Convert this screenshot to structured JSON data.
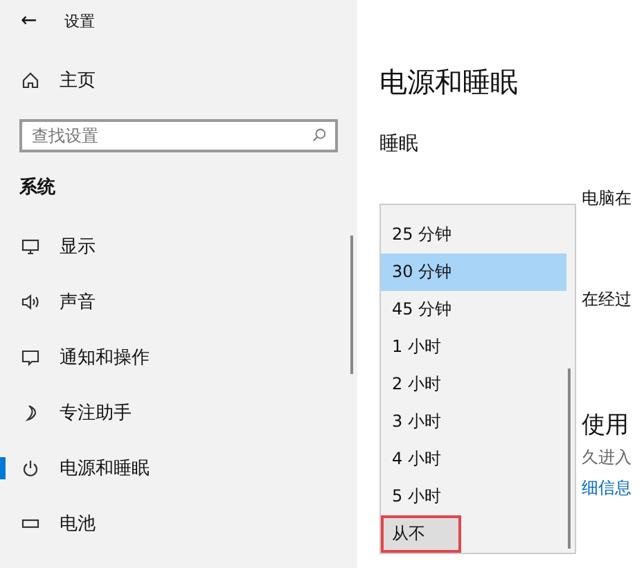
{
  "window": {
    "back": "←",
    "title": "设置"
  },
  "sidebar": {
    "home": "主页",
    "search": {
      "placeholder": "查找设置"
    },
    "section": "系统",
    "items": [
      {
        "label": "显示",
        "selected": false
      },
      {
        "label": "声音",
        "selected": false
      },
      {
        "label": "通知和操作",
        "selected": false
      },
      {
        "label": "专注助手",
        "selected": false
      },
      {
        "label": "电源和睡眠",
        "selected": true
      },
      {
        "label": "电池",
        "selected": false
      }
    ]
  },
  "main": {
    "title": "电源和睡眠",
    "section": "睡眠",
    "line_1": "电脑在",
    "line_2": "在经过",
    "heading_2": "使用",
    "line_3": "久进入",
    "link": "细信息"
  },
  "dropdown": {
    "options": [
      {
        "label": "25 分钟",
        "selected": false,
        "highlighted": false
      },
      {
        "label": "30 分钟",
        "selected": true,
        "highlighted": false
      },
      {
        "label": "45 分钟",
        "selected": false,
        "highlighted": false
      },
      {
        "label": "1 小时",
        "selected": false,
        "highlighted": false
      },
      {
        "label": "2 小时",
        "selected": false,
        "highlighted": false
      },
      {
        "label": "3 小时",
        "selected": false,
        "highlighted": false
      },
      {
        "label": "4 小时",
        "selected": false,
        "highlighted": false
      },
      {
        "label": "5 小时",
        "selected": false,
        "highlighted": false
      },
      {
        "label": "从不",
        "selected": false,
        "highlighted": true
      }
    ]
  }
}
